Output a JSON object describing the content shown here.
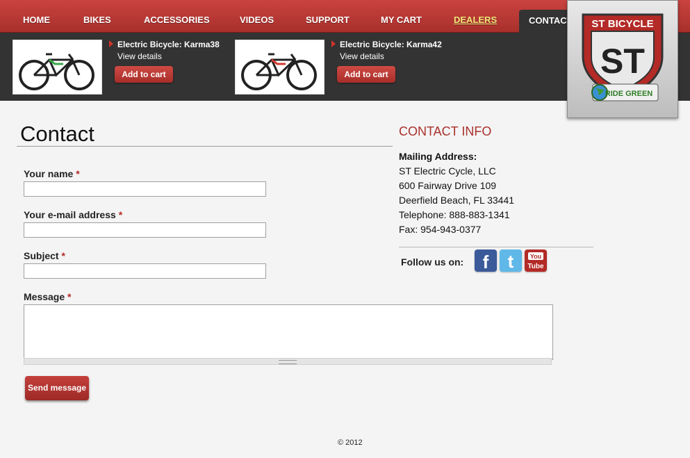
{
  "nav": {
    "home": "HOME",
    "bikes": "BIKES",
    "accessories": "ACCESSORIES",
    "videos": "VIDEOS",
    "support": "SUPPORT",
    "my_cart": "MY CART",
    "dealers": "DEALERS",
    "contact": "CONTACT"
  },
  "products": [
    {
      "title": "Electric Bicycle: Karma38",
      "details": "View details",
      "cart": "Add to cart",
      "accent": "#3aa84a"
    },
    {
      "title": "Electric Bicycle: Karma42",
      "details": "View details",
      "cart": "Add to cart",
      "accent": "#d23a30"
    }
  ],
  "logo": {
    "top_text": "ST BICYCLE",
    "mark": "ST",
    "tagline": "RIDE GREEN"
  },
  "contact": {
    "title": "Contact",
    "fields": {
      "name": {
        "label": "Your name",
        "req": "*",
        "value": ""
      },
      "email": {
        "label": "Your e-mail address",
        "req": "*",
        "value": ""
      },
      "subject": {
        "label": "Subject",
        "req": "*",
        "value": ""
      },
      "message": {
        "label": "Message",
        "req": "*",
        "value": ""
      }
    },
    "send_label": "Send message"
  },
  "info": {
    "heading": "CONTACT INFO",
    "mailing_label": "Mailing Address:",
    "company": "ST Electric Cycle, LLC",
    "street": "600 Fairway Drive 109",
    "city": "Deerfield Beach, FL 33441",
    "telephone": "Telephone: 888-883-1341",
    "fax": "Fax: 954-943-0377",
    "follow": "Follow us on:",
    "social": {
      "facebook": "f",
      "twitter": "t",
      "youtube_top": "You",
      "youtube_bottom": "Tube"
    }
  },
  "footer": "© 2012",
  "colors": {
    "brand_red": "#a9302b",
    "dark_strip": "#333333",
    "page_bg": "#f4f4f4"
  }
}
